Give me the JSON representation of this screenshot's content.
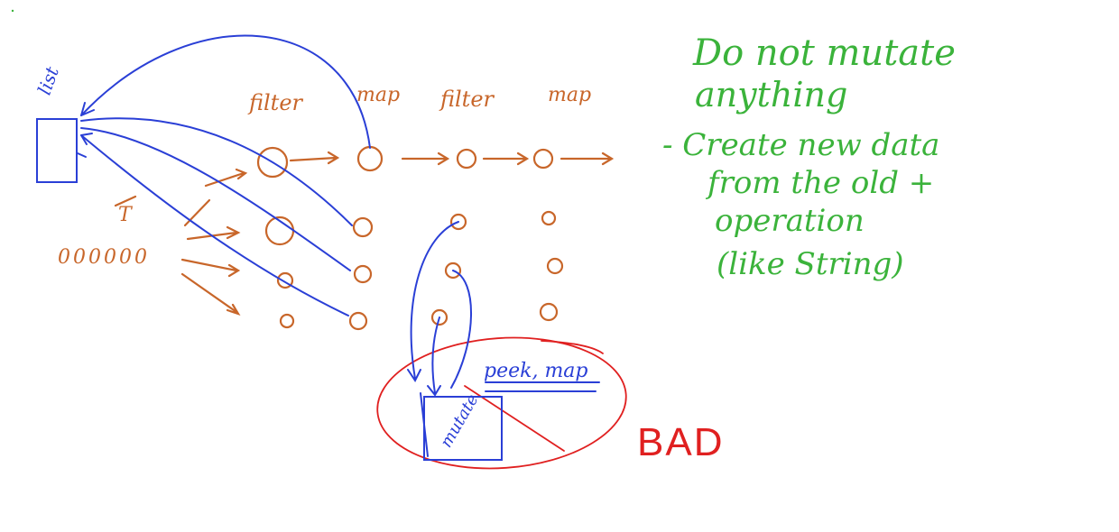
{
  "labels": {
    "list": "list",
    "header": [
      "filter",
      "map",
      "filter",
      "map"
    ],
    "zeros": "000000",
    "t_arrow": "T",
    "peek_map": "peek, map",
    "mutate": "mutate",
    "bad": "BAD"
  },
  "notes": {
    "line1": "Do not mutate",
    "line2": "anything",
    "line3": "- Create new data",
    "line4": "from the old +",
    "line5": "operation",
    "line6": "(like String)"
  },
  "colors": {
    "orange": "#c8662a",
    "blue": "#2a3fd6",
    "green": "#3bb33b",
    "red": "#e02020"
  }
}
